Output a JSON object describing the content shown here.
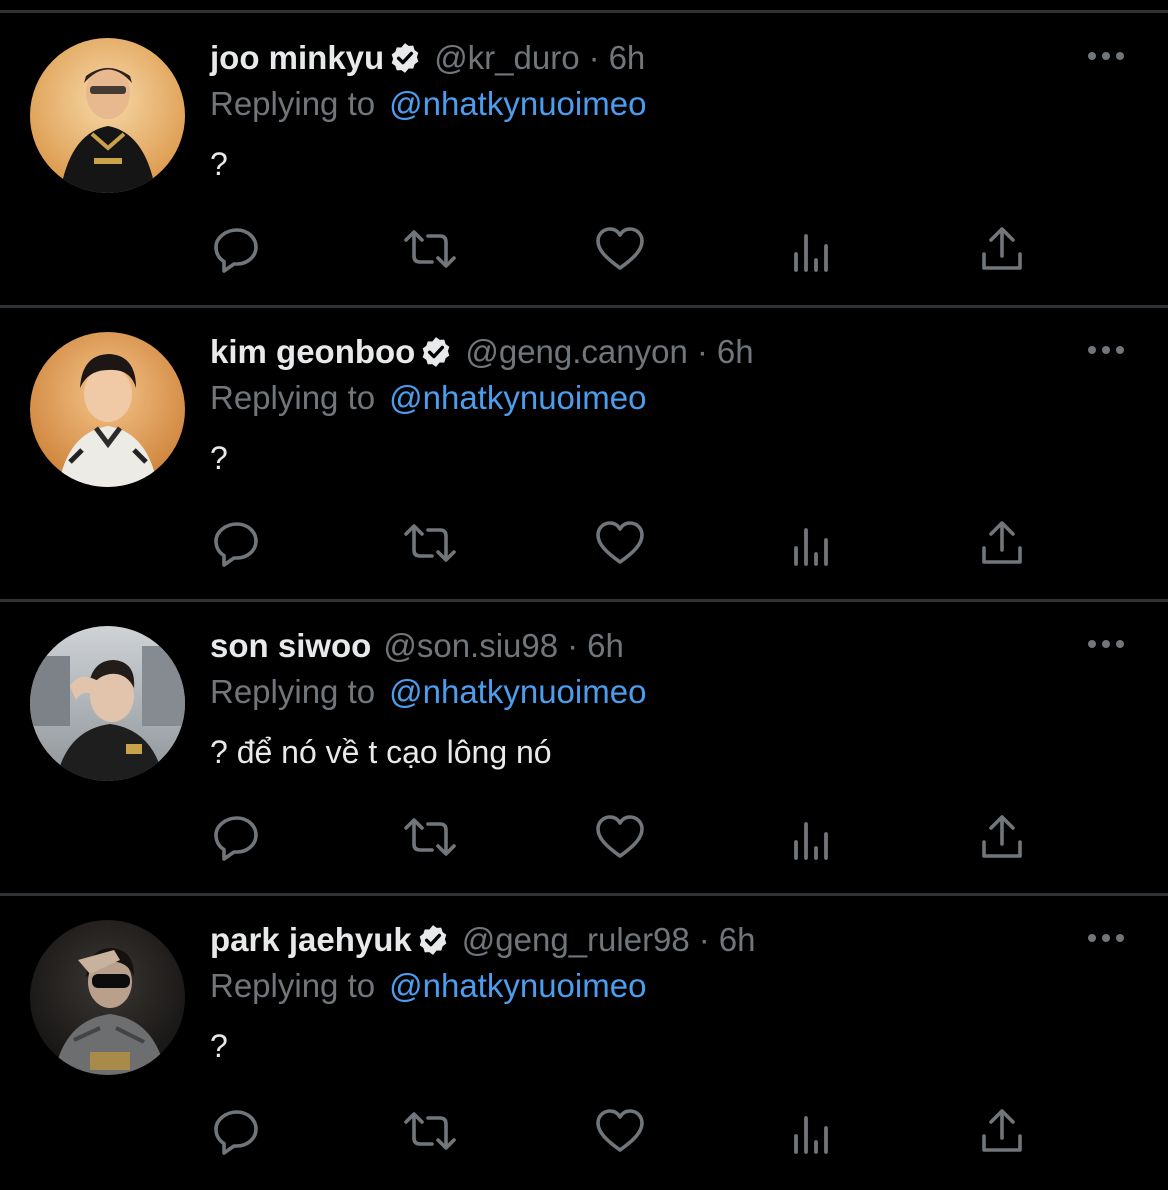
{
  "theme": {
    "background": "#000000",
    "divider": "#2f3336",
    "text_primary": "#e7e9ea",
    "text_secondary": "#71767b",
    "link": "#4c9ded"
  },
  "tweets": [
    {
      "display_name": "joo minkyu",
      "verified": true,
      "handle": "@kr_duro",
      "separator": "·",
      "time": "6h",
      "reply_prefix": "Replying to",
      "reply_target": "@nhatkynuoimeo",
      "text": "?",
      "avatar_icon": "user-avatar-photo"
    },
    {
      "display_name": "kim geonboo",
      "verified": true,
      "handle": "@geng.canyon",
      "separator": "·",
      "time": "6h",
      "reply_prefix": "Replying to",
      "reply_target": "@nhatkynuoimeo",
      "text": "?",
      "avatar_icon": "user-avatar-photo"
    },
    {
      "display_name": "son siwoo",
      "verified": false,
      "handle": "@son.siu98",
      "separator": "·",
      "time": "6h",
      "reply_prefix": "Replying to",
      "reply_target": "@nhatkynuoimeo",
      "text": "? để nó về t cạo lông nó",
      "avatar_icon": "user-avatar-photo"
    },
    {
      "display_name": "park jaehyuk",
      "verified": true,
      "handle": "@geng_ruler98",
      "separator": "·",
      "time": "6h",
      "reply_prefix": "Replying to",
      "reply_target": "@nhatkynuoimeo",
      "text": "?",
      "avatar_icon": "user-avatar-photo"
    }
  ],
  "action_icons": [
    "reply-icon",
    "retweet-icon",
    "like-icon",
    "views-icon",
    "share-icon"
  ]
}
